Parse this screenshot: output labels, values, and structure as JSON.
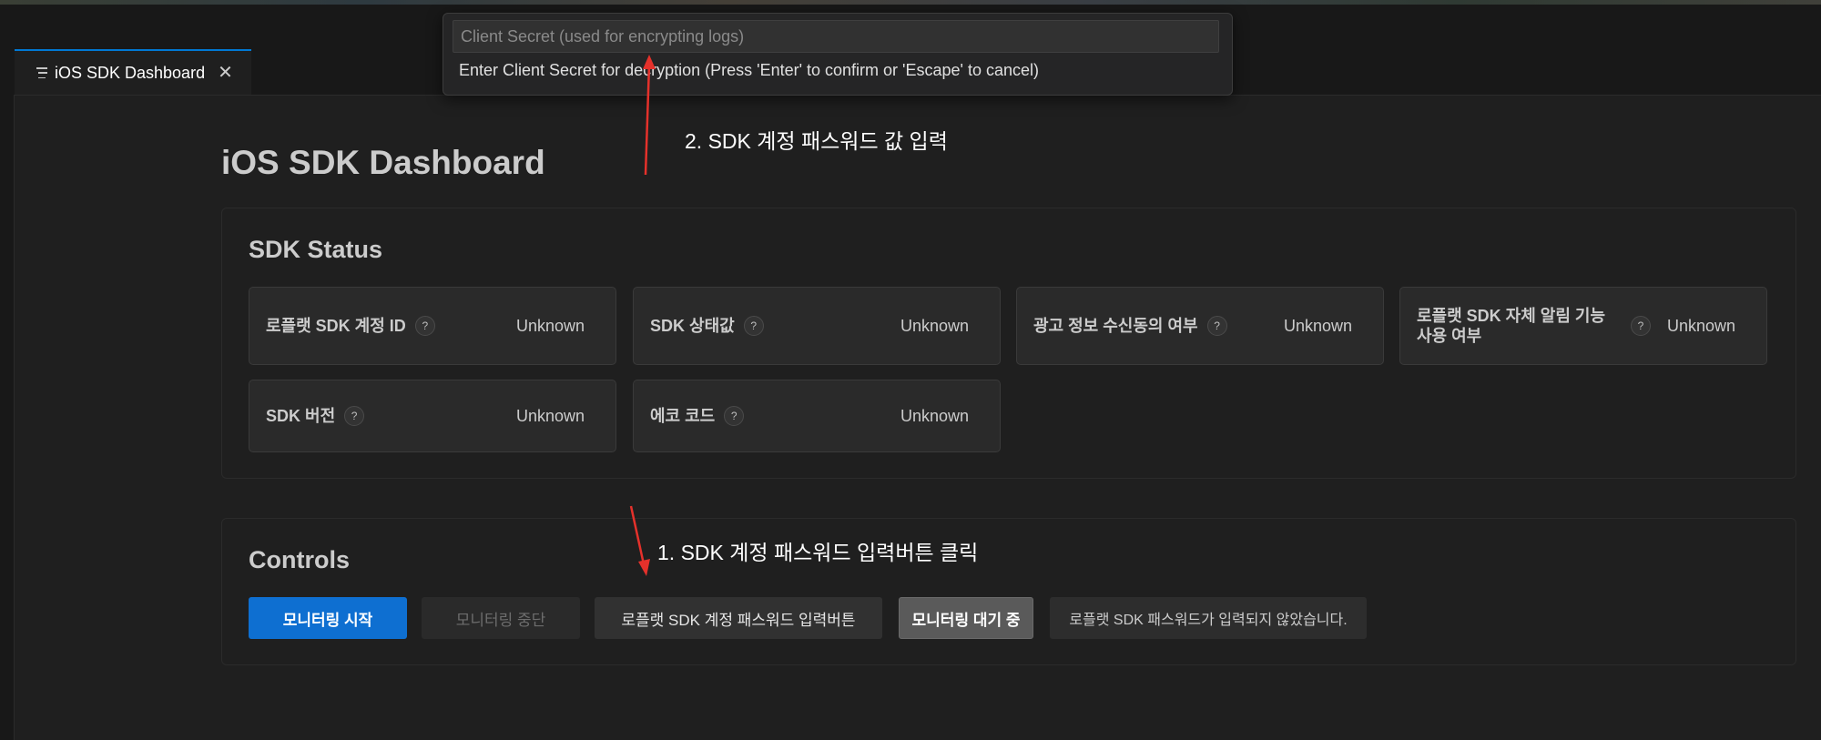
{
  "tab": {
    "title": "iOS SDK Dashboard",
    "close": "✕"
  },
  "quick_input": {
    "placeholder": "Client Secret (used for encrypting logs)",
    "message": "Enter Client Secret for decryption (Press 'Enter' to confirm or 'Escape' to cancel)"
  },
  "page_title": "iOS SDK Dashboard",
  "status": {
    "title": "SDK Status",
    "help_glyph": "?",
    "items": [
      {
        "label": "로플랫 SDK 계정 ID",
        "value": "Unknown"
      },
      {
        "label": "SDK 상태값",
        "value": "Unknown"
      },
      {
        "label": "광고 정보 수신동의 여부",
        "value": "Unknown"
      },
      {
        "label": "로플랫 SDK 자체 알림 기능 사용 여부",
        "value": "Unknown"
      },
      {
        "label": "SDK 버전",
        "value": "Unknown"
      },
      {
        "label": "에코 코드",
        "value": "Unknown"
      }
    ]
  },
  "controls": {
    "title": "Controls",
    "start_label": "모니터링 시작",
    "stop_label": "모니터링 중단",
    "password_label": "로플랫 SDK 계정 패스워드 입력버튼",
    "state_badge": "모니터링 대기 중",
    "message": "로플랫 SDK 패스워드가 입력되지 않았습니다."
  },
  "annotations": {
    "step1": "1. SDK 계정 패스워드 입력버튼 클릭",
    "step2": "2. SDK 계정 패스워드 값 입력"
  },
  "colors": {
    "accent": "#0e6fd1",
    "tab_indicator": "#0078d4",
    "arrow": "#e5312b"
  }
}
